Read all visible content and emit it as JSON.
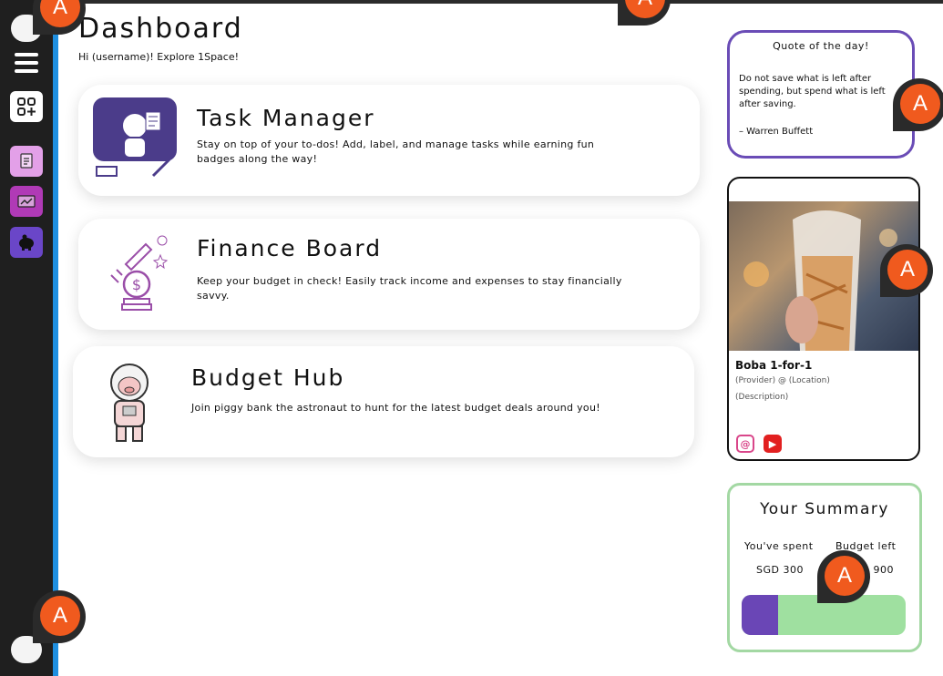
{
  "header": {
    "title": "Dashboard",
    "subtitle": "Hi (username)! Explore 1Space!"
  },
  "cards": [
    {
      "title": "Task Manager",
      "desc": "Stay on top of your to-dos! Add, label, and manage tasks while earning fun badges along the way!",
      "icon": "astronaut-task-illustration"
    },
    {
      "title": "Finance Board",
      "desc": "Keep your budget in check! Easily track income and expenses to stay financially savvy.",
      "icon": "rocket-money-illustration"
    },
    {
      "title": "Budget Hub",
      "desc": "Join piggy bank the astronaut to hunt for the latest budget deals around you!",
      "icon": "piggy-astronaut-illustration"
    }
  ],
  "quote": {
    "heading": "Quote of the day!",
    "text": "Do not save what is left after spending, but spend what is left after saving.",
    "author": "– Warren Buffett"
  },
  "deal": {
    "title": "Boba 1-for-1",
    "provider": "(Provider) @ (Location)",
    "description": "(Description)",
    "image": "boba-drink-photo",
    "socials": [
      "instagram-icon",
      "youtube-icon"
    ]
  },
  "summary": {
    "heading": "Your Summary",
    "spent_label": "You've spent",
    "spent_value": "SGD 300",
    "left_label": "Budget left",
    "left_value": "SGD 900",
    "spent_fraction": 0.22
  },
  "overlay_badge": "A",
  "colors": {
    "sidebar": "#1f1f1f",
    "accent_blue": "#1f8fe0",
    "quote_border": "#6a4cb6",
    "summary_border": "#a3d8a3",
    "bar_spent": "#6a46b6",
    "bar_left": "#9fe0a0",
    "badge": "#f05a1e"
  }
}
